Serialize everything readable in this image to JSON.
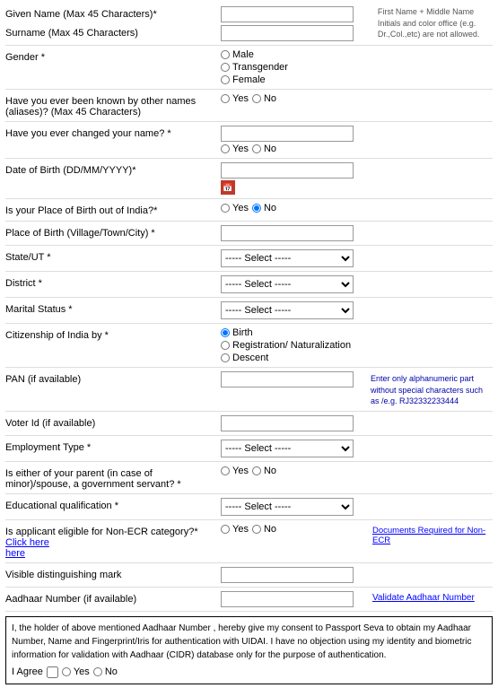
{
  "form": {
    "given_name_label": "Given Name (Max 45 Characters)*",
    "surname_label": "Surname (Max 45 Characters)",
    "gender_label": "Gender *",
    "gender_options": [
      "Male",
      "Transgender",
      "Female"
    ],
    "aliases_label": "Have you ever been known by other names (aliases)? (Max 45 Characters)",
    "name_changed_label": "Have you ever changed your name? *",
    "dob_label": "Date of Birth (DD/MM/YYYY)*",
    "place_birth_out_label": "Is your Place of Birth out of India?*",
    "place_birth_label": "Place of Birth (Village/Town/City) *",
    "state_label": "State/UT *",
    "district_label": "District *",
    "marital_label": "Marital Status *",
    "citizenship_label": "Citizenship of India by *",
    "citizenship_options": [
      "Birth",
      "Registration/ Naturalization",
      "Descent"
    ],
    "pan_label": "PAN (if available)",
    "voter_id_label": "Voter Id (if available)",
    "employment_label": "Employment Type *",
    "parent_govt_label": "Is either of your parent (in case of minor)/spouse, a government servant? *",
    "education_label": "Educational qualification *",
    "non_ecr_label": "Is applicant eligible for Non-ECR category?*",
    "non_ecr_click": "Click here",
    "distinguish_label": "Visible distinguishing mark",
    "aadhaar_label": "Aadhaar Number (if available)",
    "yes_label": "Yes",
    "no_label": "No",
    "select_placeholder": "----- Select -----",
    "firstname_note": "First Name + Middle Name Initials and color office (e.g. Dr.,Col.,etc) are not allowed.",
    "pan_note": "Enter only alphanumeric part without special characters such as /e.g. RJ32332233444",
    "validate_aadhaar": "Validate Aadhaar Number",
    "docs_non_ecr": "Documents Required for Non-ECR",
    "consent_text": "I, the holder of above mentioned Aadhaar Number , hereby give my consent to Passport Seva to obtain my Aadhaar Number, Name and Fingerprint/Iris for authentication with UIDAI. I have no objection using my identity and biometric information for validation with Aadhaar (CIDR) database only for the purpose of authentication.",
    "i_agree_label": "I Agree",
    "yes_agree_label": "Yes",
    "no_agree_label": "No"
  }
}
